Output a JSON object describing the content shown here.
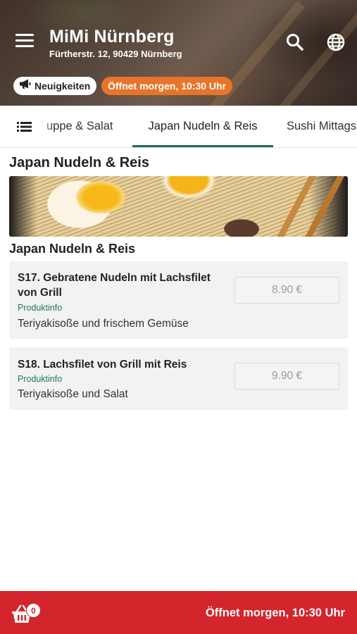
{
  "header": {
    "title": "MiMi Nürnberg",
    "address": "Fürtherstr. 12, 90429 Nürnberg",
    "news_label": "Neuigkeiten",
    "open_status": "Öffnet morgen, 10:30 Uhr",
    "icons": [
      "hamburger-menu-icon",
      "search-icon",
      "globe-icon",
      "megaphone-icon"
    ]
  },
  "tabs": {
    "items": [
      {
        "label": "uppe & Salat"
      },
      {
        "label": "Japan Nudeln & Reis",
        "active": true
      },
      {
        "label": "Sushi Mittags"
      }
    ]
  },
  "main": {
    "section_title": "Japan Nudeln & Reis",
    "subsection_title": "Japan Nudeln & Reis",
    "items": [
      {
        "name": "S17. Gebratene Nudeln mit Lachsfilet von Grill",
        "info": "Produktinfo",
        "description": "Teriyakisoße und frischem Gemüse",
        "price": "8.90 €"
      },
      {
        "name": "S18. Lachsfilet von Grill mit Reis",
        "info": "Produktinfo",
        "description": "Teriyakisoße und Salat",
        "price": "9.90 €"
      }
    ]
  },
  "bottom_bar": {
    "basket_count": "0",
    "status": "Öffnet morgen, 10:30 Uhr"
  },
  "colors": {
    "accent_green": "#1f6a52",
    "open_badge_orange": "#e8742a",
    "bottom_bar_red": "#d2252c",
    "card_background": "#f2f2f2"
  }
}
